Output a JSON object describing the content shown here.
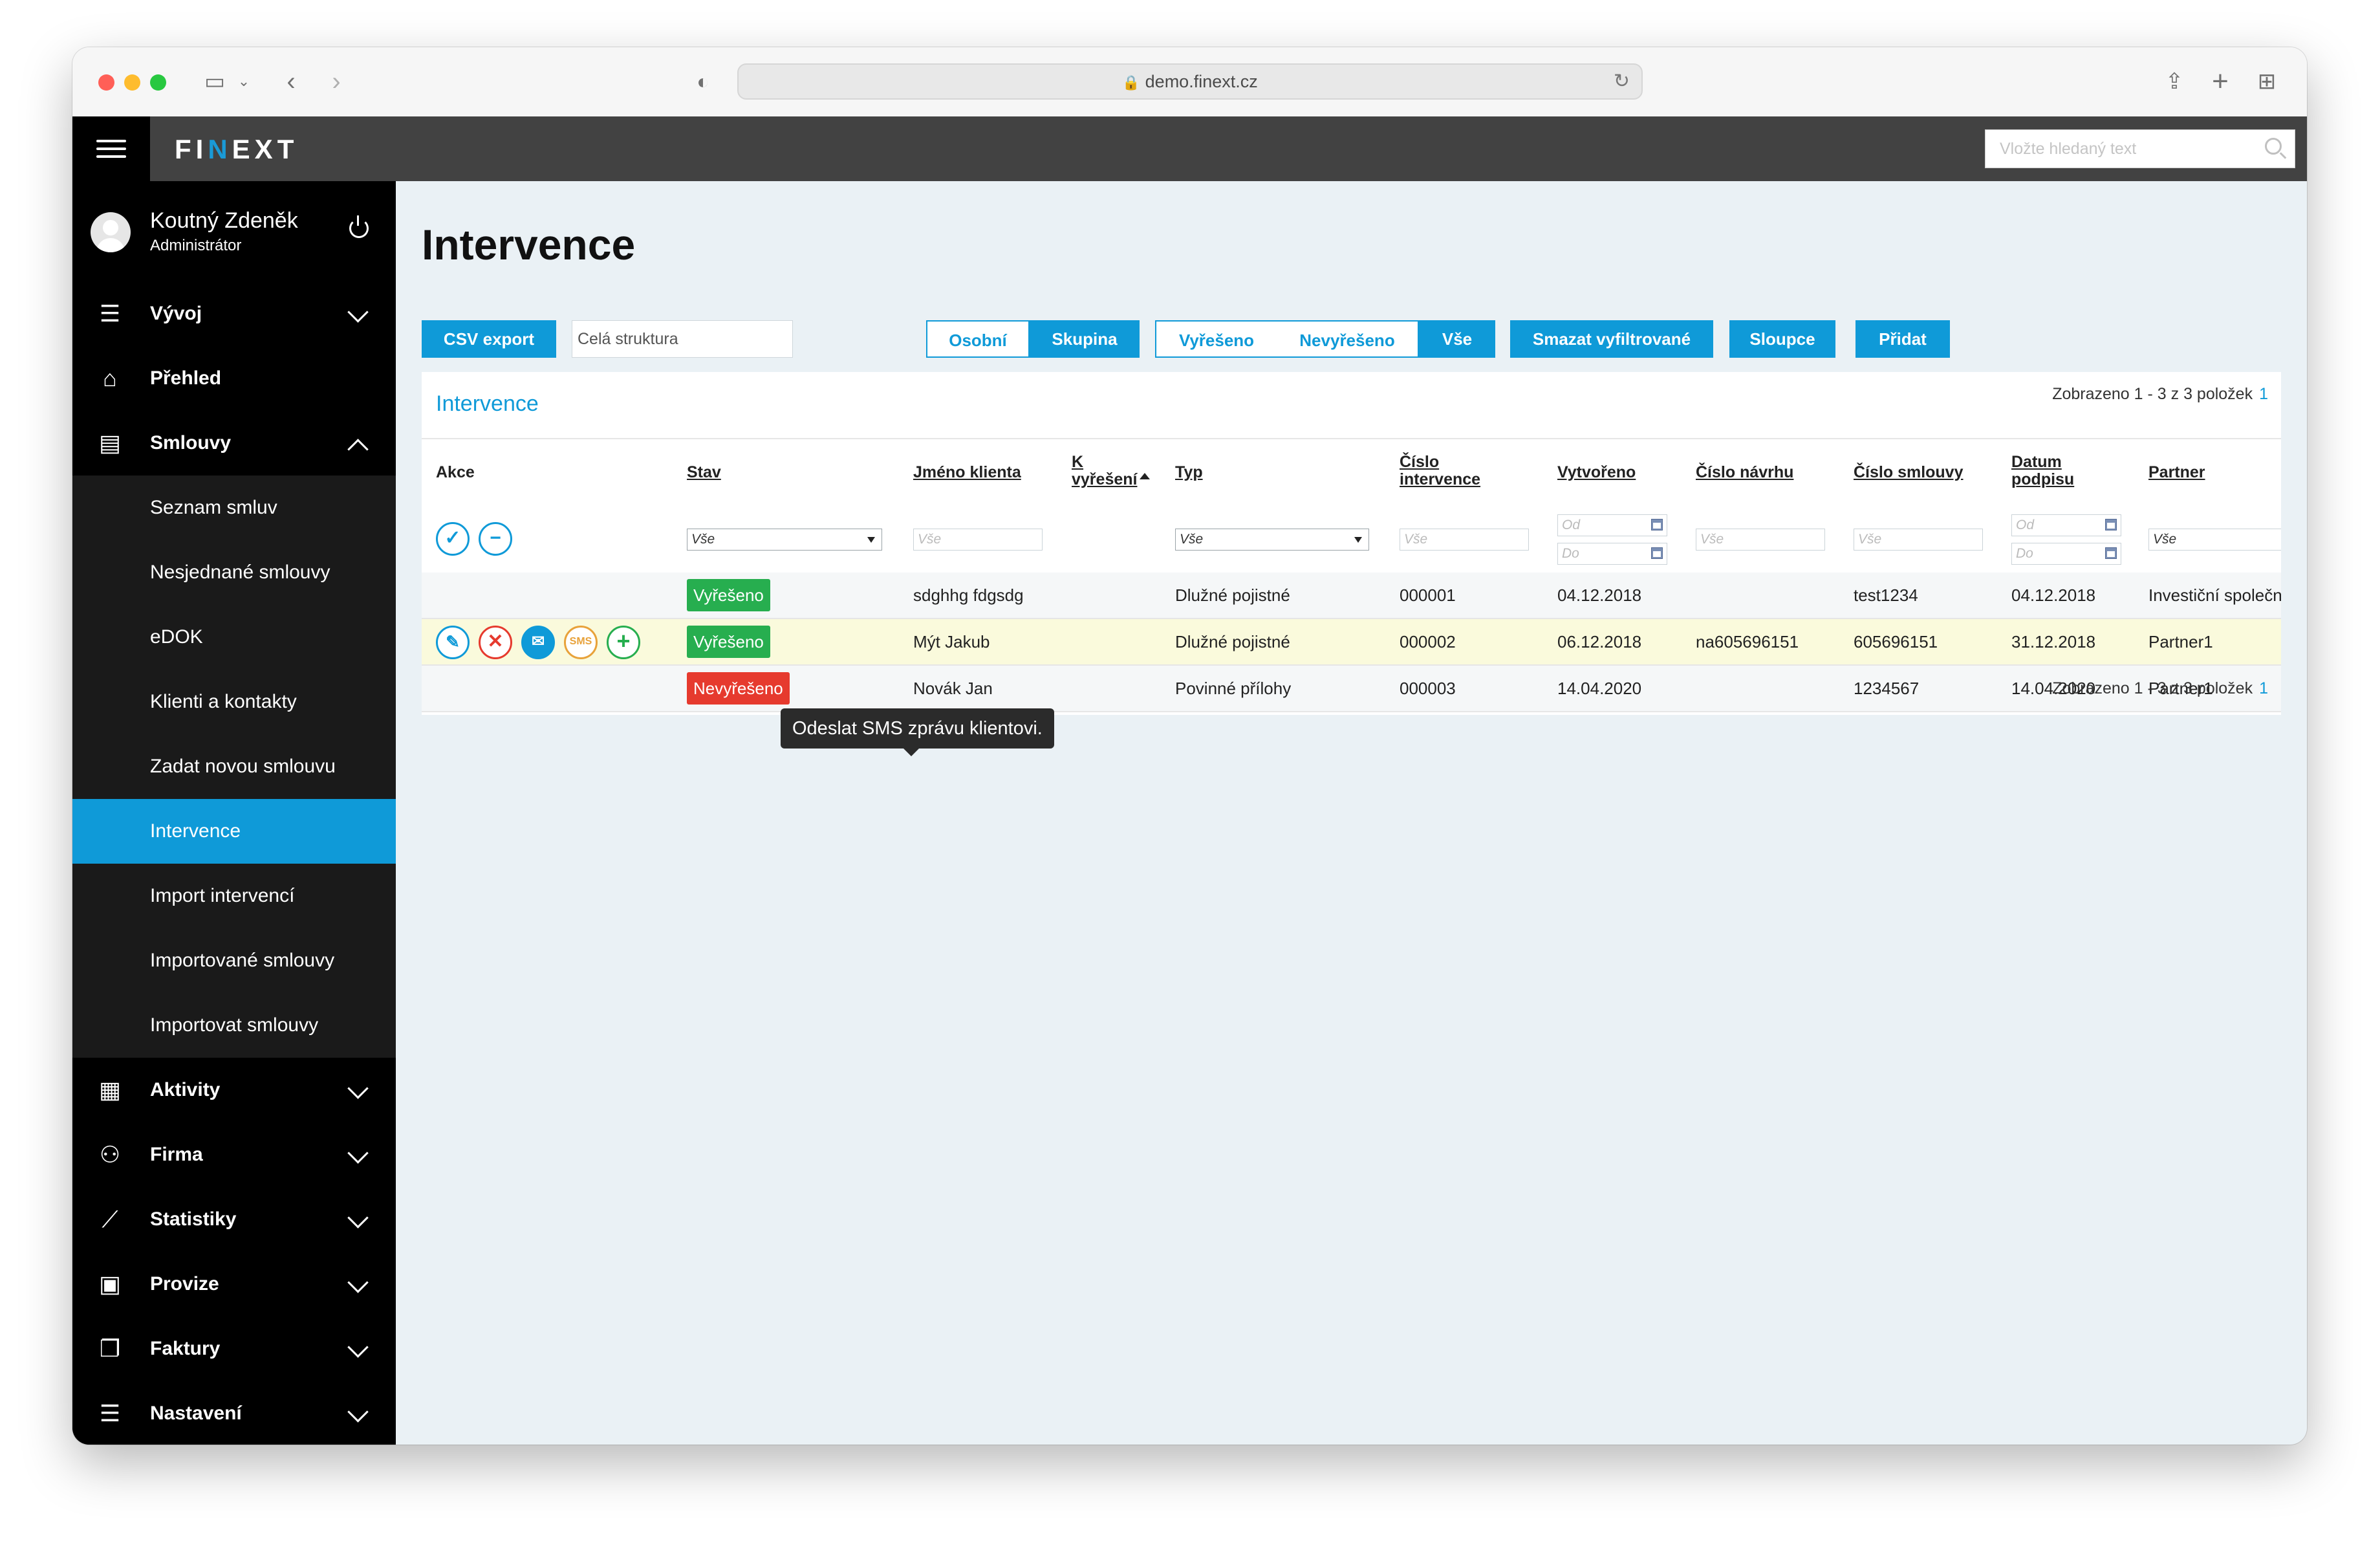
{
  "browser": {
    "url": "demo.finext.cz"
  },
  "app": {
    "logo": "FINEXT",
    "search_placeholder": "Vložte hledaný text"
  },
  "user": {
    "name": "Koutný Zdeněk",
    "role": "Administrátor"
  },
  "sidebar": {
    "items": [
      {
        "label": "Vývoj",
        "icon": "sliders-icon"
      },
      {
        "label": "Přehled",
        "icon": "home-icon"
      },
      {
        "label": "Smlouvy",
        "icon": "contracts-icon"
      },
      {
        "label": "Seznam smluv"
      },
      {
        "label": "Nesjednané smlouvy"
      },
      {
        "label": "eDOK"
      },
      {
        "label": "Klienti a kontakty"
      },
      {
        "label": "Zadat novou smlouvu"
      },
      {
        "label": "Intervence"
      },
      {
        "label": "Import intervencí"
      },
      {
        "label": "Importované smlouvy"
      },
      {
        "label": "Importovat smlouvy"
      },
      {
        "label": "Aktivity",
        "icon": "calendar-icon"
      },
      {
        "label": "Firma",
        "icon": "users-icon"
      },
      {
        "label": "Statistiky",
        "icon": "chart-icon"
      },
      {
        "label": "Provize",
        "icon": "wallet-icon"
      },
      {
        "label": "Faktury",
        "icon": "document-icon"
      },
      {
        "label": "Nastavení",
        "icon": "settings-icon"
      }
    ]
  },
  "page": {
    "title": "Intervence"
  },
  "toolbar": {
    "csv": "CSV export",
    "scope": "Celá struktura",
    "osobni": "Osobní",
    "skupina": "Skupina",
    "vyreseno": "Vyřešeno",
    "nevyreseno": "Nevyřešeno",
    "vse": "Vše",
    "smazat": "Smazat vyfiltrované",
    "sloupce": "Sloupce",
    "pridat": "Přidat"
  },
  "panel": {
    "title": "Intervence",
    "count_text": "Zobrazeno 1 - 3 z 3 položek",
    "page": "1"
  },
  "table": {
    "headers": {
      "akce": "Akce",
      "stav": "Stav",
      "jmeno": "Jméno klienta",
      "k_vyreseni_1": "K",
      "k_vyreseni_2": "vyřešení",
      "typ": "Typ",
      "cislo_int_1": "Číslo",
      "cislo_int_2": "intervence",
      "vytvoreno": "Vytvořeno",
      "cislo_navrhu": "Číslo návrhu",
      "cislo_smlouvy": "Číslo smlouvy",
      "datum_1": "Datum",
      "datum_2": "podpisu",
      "partner": "Partner"
    },
    "filters": {
      "vse": "Vše",
      "od": "Od",
      "do": "Do"
    },
    "rows": [
      {
        "stav": "Vyřešeno",
        "jmeno": "sdghhg fdgsdg",
        "typ": "Dlužné pojistné",
        "cislo": "000001",
        "vytvoreno": "04.12.2018",
        "navrh": "",
        "smlouva": "test1234",
        "datum": "04.12.2018",
        "partner": "Investiční společn"
      },
      {
        "stav": "Vyřešeno",
        "jmeno": "Mýt Jakub",
        "typ": "Dlužné pojistné",
        "cislo": "000002",
        "vytvoreno": "06.12.2018",
        "navrh": "na605696151",
        "smlouva": "605696151",
        "datum": "31.12.2018",
        "partner": "Partner1"
      },
      {
        "stav": "Nevyřešeno",
        "jmeno": "Novák Jan",
        "typ": "Povinné přílohy",
        "cislo": "000003",
        "vytvoreno": "14.04.2020",
        "navrh": "",
        "smlouva": "1234567",
        "datum": "14.04.2020",
        "partner": "Partner1"
      }
    ],
    "sms_label": "SMS"
  },
  "tooltip": "Odeslat SMS zprávu klientovi.",
  "colors": {
    "accent": "#0f9ad8",
    "success": "#27ae4f",
    "danger": "#e63a2e",
    "highlight_row": "#fafadc"
  }
}
